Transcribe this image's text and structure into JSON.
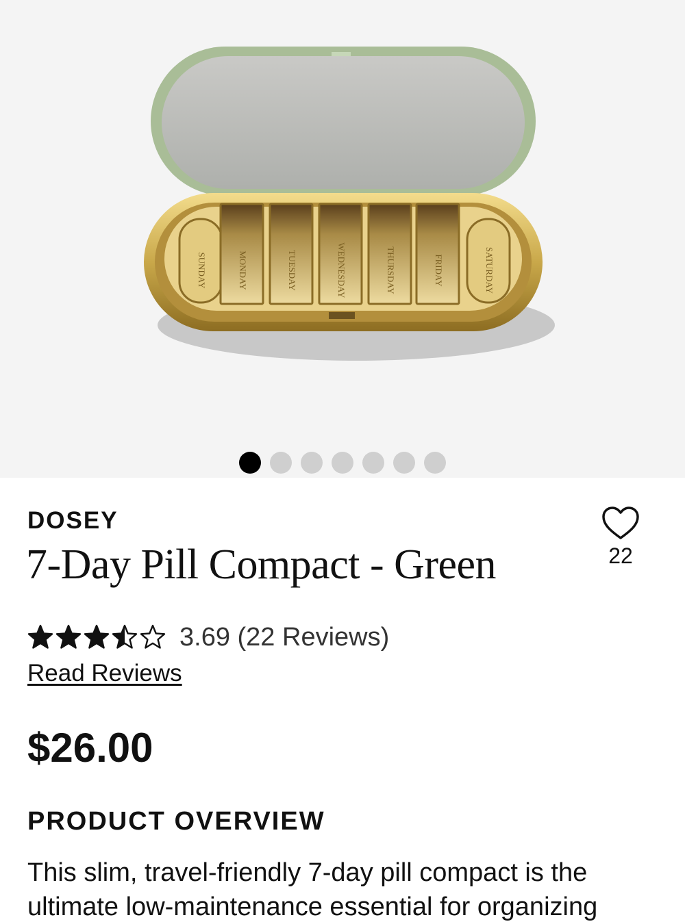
{
  "gallery": {
    "image_alt": "DOSEY 7-Day Pill Compact - Green",
    "day_labels": [
      "SUNDAY",
      "MONDAY",
      "TUESDAY",
      "WEDNESDAY",
      "THURSDAY",
      "FRIDAY",
      "SATURDAY"
    ],
    "dot_count": 7,
    "active_index": 0
  },
  "product": {
    "brand": "DOSEY",
    "name": "7-Day Pill Compact - Green",
    "wishlist_count": "22",
    "rating": {
      "stars_value": 3.69,
      "stars_max": 5,
      "text": "3.69 (22 Reviews)",
      "read_reviews_label": "Read Reviews"
    },
    "price": "$26.00"
  },
  "overview": {
    "heading": "PRODUCT OVERVIEW",
    "body": "This slim, travel-friendly 7-day pill compact is the ultimate low-maintenance essential for organizing"
  },
  "colors": {
    "lid_green": "#a9bd97",
    "gold": "#c9a84a",
    "dot_active": "#000000",
    "dot_inactive": "#cfcfcf"
  }
}
